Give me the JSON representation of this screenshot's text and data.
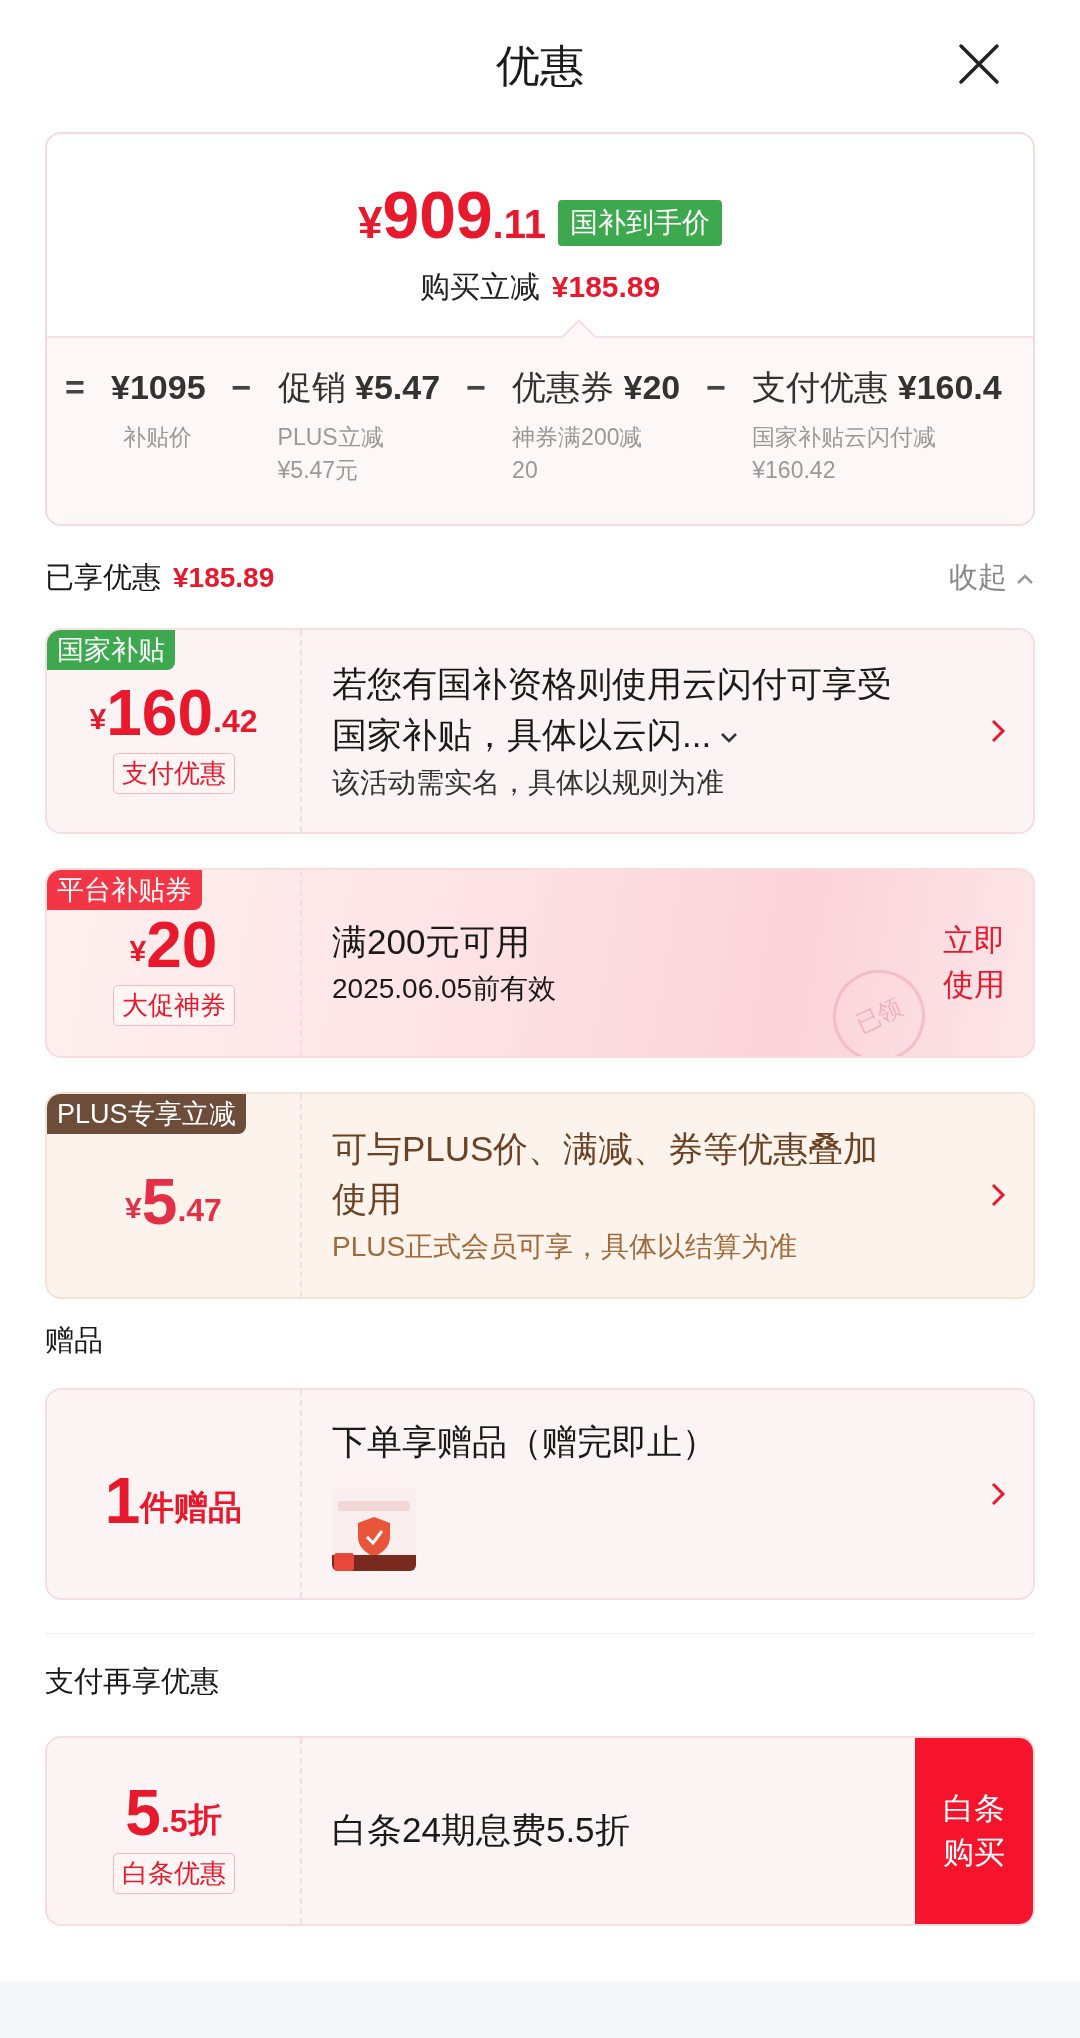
{
  "header": {
    "title": "优惠"
  },
  "summary": {
    "price": {
      "symbol": "¥",
      "integer": "909",
      "decimal": ".11"
    },
    "badge": "国补到手价",
    "saving_label": "购买立减",
    "saving_value": "¥185.89",
    "breakdown": [
      {
        "operator": "=",
        "value": "¥1095",
        "notes": [
          "补贴价"
        ]
      },
      {
        "operator": "−",
        "label": "促销",
        "value": "¥5.47",
        "notes": [
          "PLUS立减",
          "¥5.47元"
        ]
      },
      {
        "operator": "−",
        "label": "优惠券",
        "value": "¥20",
        "notes": [
          "神券满200减",
          "20"
        ]
      },
      {
        "operator": "−",
        "label": "支付优惠",
        "value": "¥160.4",
        "notes": [
          "国家补贴云闪付减",
          "¥160.42"
        ]
      }
    ]
  },
  "applied": {
    "title": "已享优惠",
    "amount": "¥185.89",
    "toggle": "收起",
    "expanded": true,
    "offers": [
      {
        "kind": "payment",
        "tag": "国家补贴",
        "amount": {
          "symbol": "¥",
          "integer": "160",
          "decimal": ".42"
        },
        "label": "支付优惠",
        "title": "若您有国补资格则使用云闪付可享受国家补贴，具体以云闪...",
        "more": true,
        "subtitle": "该活动需实名，具体以规则为准",
        "action": {
          "kind": "arrow"
        }
      },
      {
        "kind": "coupon",
        "tag": "平台补贴券",
        "amount": {
          "symbol": "¥",
          "integer": "20"
        },
        "label": "大促神券",
        "title": "满200元可用",
        "more": false,
        "subtitle": "2025.06.05前有效",
        "stamp": "已领",
        "action": {
          "kind": "button",
          "lines": [
            "立即",
            "使用"
          ]
        }
      },
      {
        "kind": "plus",
        "tag": "PLUS专享立减",
        "amount": {
          "symbol": "¥",
          "integer": "5",
          "decimal": ".47"
        },
        "title": "可与PLUS价、满减、券等优惠叠加使用",
        "more": false,
        "subtitle": "PLUS正式会员可享，具体以结算为准",
        "action": {
          "kind": "arrow"
        }
      }
    ]
  },
  "gifts": {
    "title": "赠品",
    "offers": [
      {
        "kind": "gift",
        "amount": {
          "integer": "1",
          "unit": "件赠品"
        },
        "title": "下单享赠品（赠完即止）",
        "more": false,
        "action": {
          "kind": "arrow"
        }
      }
    ]
  },
  "pay_more": {
    "title": "支付再享优惠",
    "offers": [
      {
        "kind": "credit",
        "amount": {
          "integer": "5",
          "decimal": ".5",
          "unit": "折"
        },
        "label": "白条优惠",
        "title": "白条24期息费5.5折",
        "more": false,
        "action": {
          "kind": "button",
          "lines": [
            "白条",
            "购买"
          ]
        }
      }
    ]
  }
}
